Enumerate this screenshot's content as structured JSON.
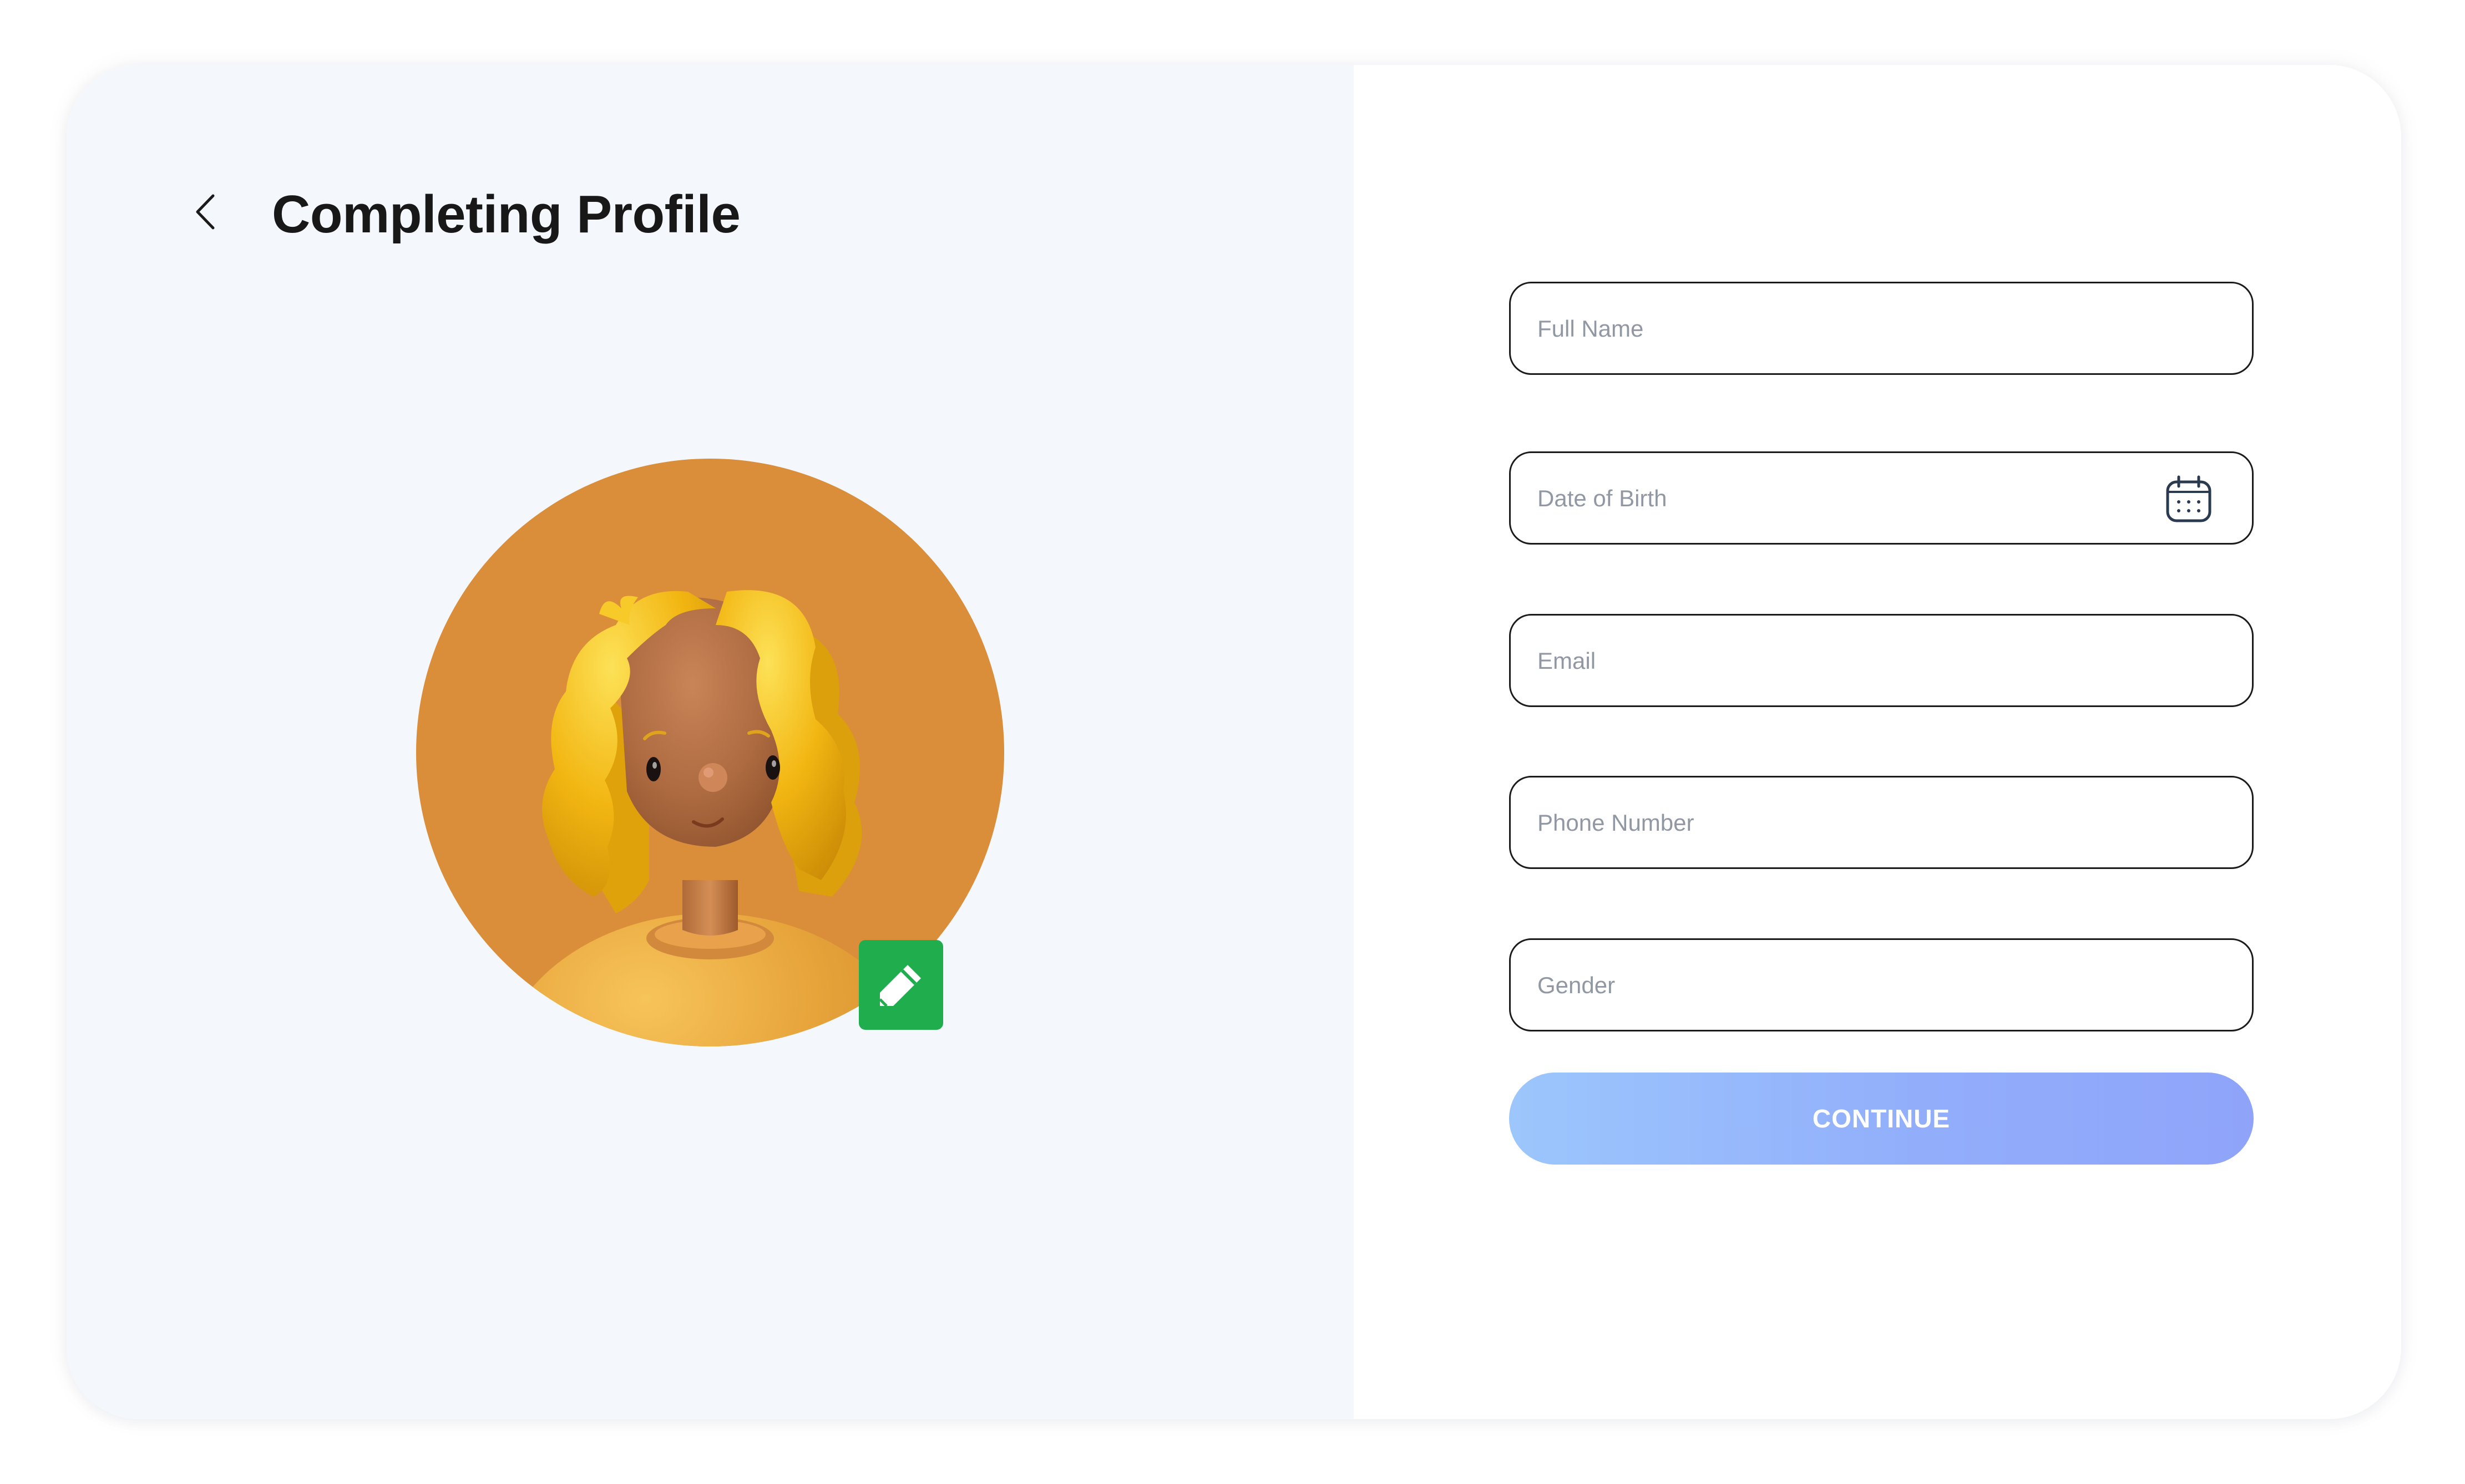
{
  "header": {
    "back_icon": "chevron-left-icon",
    "title": "Completing Profile"
  },
  "avatar": {
    "background_color": "#DB8E3A",
    "hair_color": "#F2B612",
    "edit_icon": "pencil-icon",
    "edit_button_color": "#1FAD4E"
  },
  "form": {
    "fields": [
      {
        "name": "full-name",
        "placeholder": "Full Name",
        "value": ""
      },
      {
        "name": "date-of-birth",
        "placeholder": "Date of Birth",
        "value": "",
        "icon": "calendar-icon"
      },
      {
        "name": "email",
        "placeholder": "Email",
        "value": ""
      },
      {
        "name": "phone-number",
        "placeholder": "Phone Number",
        "value": ""
      },
      {
        "name": "gender",
        "placeholder": "Gender",
        "value": ""
      }
    ],
    "continue_label": "CONTINUE"
  },
  "colors": {
    "left_panel_bg": "#F4F8FD",
    "button_gradient_start": "#9CC6FC",
    "button_gradient_end": "#8FA4F9"
  }
}
